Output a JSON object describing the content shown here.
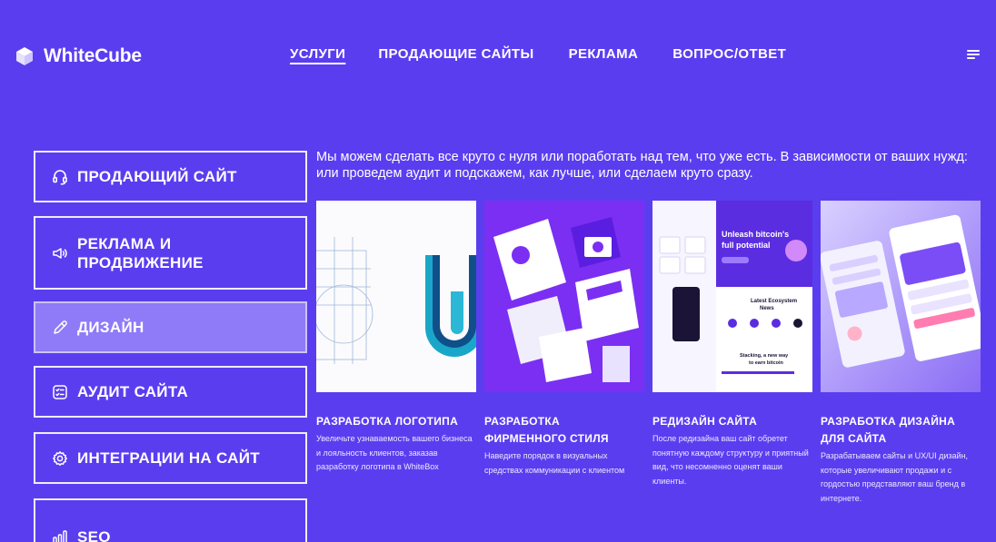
{
  "brand": {
    "name": "WhiteCube"
  },
  "nav": {
    "items": [
      {
        "label": "УСЛУГИ",
        "active": true
      },
      {
        "label": "ПРОДАЮЩИЕ САЙТЫ"
      },
      {
        "label": "РЕКЛАМА"
      },
      {
        "label": "ВОПРОС/ОТВЕТ"
      }
    ],
    "menu_icon": "hamburger-menu-icon"
  },
  "sidebar": {
    "items": [
      {
        "label": "ПРОДАЮЩИЙ САЙТ",
        "icon": "headset-icon"
      },
      {
        "label": "РЕКЛАМА И ПРОДВИЖЕНИЕ",
        "icon": "megaphone-icon"
      },
      {
        "label": "ДИЗАЙН",
        "icon": "pencil-icon",
        "active": true
      },
      {
        "label": "АУДИТ САЙТА",
        "icon": "checklist-icon"
      },
      {
        "label": "ИНТЕГРАЦИИ НА САЙТ",
        "icon": "gear-icon"
      },
      {
        "label": "SEO",
        "icon": "bar-chart-icon"
      }
    ]
  },
  "main": {
    "intro": "Мы можем сделать все круто с нуля или поработать над тем, что уже есть. В зависимости от ваших нужд: или проведем аудит и подскажем, как лучше, или сделаем круто сразу.",
    "cards": [
      {
        "title": "РАЗРАБОТКА ЛОГОТИПА",
        "description": "Увеличьте узнаваемость вашего бизнеса и лояльность клиентов, заказав разработку логотипа в WhiteBox"
      },
      {
        "title": "РАЗРАБОТКА ФИРМЕННОГО СТИЛЯ",
        "description": "Наведите порядок в визуальных средствах коммуникации с клиентом"
      },
      {
        "title": "РЕДИЗАЙН САЙТА",
        "description": "После редизайна ваш сайт обретет понятную каждому структуру и приятный вид, что несомненно оценят ваши клиенты.",
        "image_text": {
          "headline": "Unleash bitcoin's full potential",
          "section": "Latest Ecosystem News",
          "footer": "Stacking, a new way to earn bitcoin"
        }
      },
      {
        "title": "РАЗРАБОТКА ДИЗАЙНА ДЛЯ САЙТА",
        "description": "Разрабатываем сайты и UX/UI дизайн, которые увеличивают продажи и с гордостью представляют ваш бренд в интернете."
      }
    ]
  },
  "colors": {
    "background": "#5b3df0",
    "active_item": "#8f7bf7",
    "text": "#ffffff"
  }
}
